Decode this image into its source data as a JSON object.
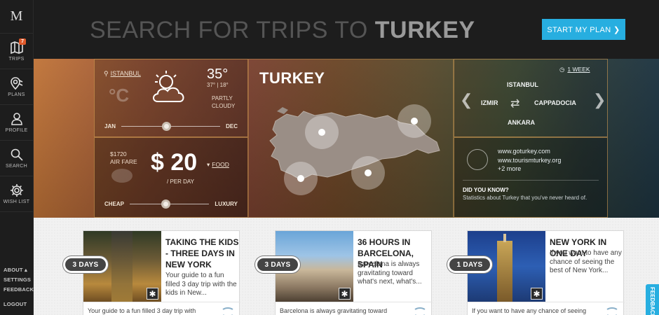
{
  "sidebar": {
    "logo": "M",
    "items": [
      {
        "label": "TRIPS",
        "badge": "7"
      },
      {
        "label": "PLANS"
      },
      {
        "label": "PROFILE"
      },
      {
        "label": "SEARCH"
      },
      {
        "label": "WISH LIST"
      }
    ],
    "bottom": {
      "about": "ABOUT ▴",
      "settings": "SETTINGS",
      "feedback": "FEEDBACK",
      "logout": "LOGOUT"
    }
  },
  "header": {
    "headline_prefix": "SEARCH FOR TRIPS TO",
    "headline_country": "TURKEY",
    "cta_label": "START MY PLAN ❯"
  },
  "weather": {
    "location": "ISTANBUL",
    "unit": "°C",
    "temp": "35°",
    "range": "37° | 18°",
    "condition": "PARTLY CLOUDY",
    "month_start": "JAN",
    "month_end": "DEC"
  },
  "budget": {
    "fare_amount": "$1720",
    "fare_label": "AIR FARE",
    "price": "$ 20",
    "per_day": "/ PER DAY",
    "category": "FOOD",
    "low": "CHEAP",
    "high": "LUXURY",
    "level": 0.45
  },
  "map": {
    "title": "TURKEY"
  },
  "cities": {
    "period": "1 WEEK",
    "north": "ISTANBUL",
    "west": "IZMIR",
    "east": "CAPPADOCIA",
    "south": "ANKARA"
  },
  "info": {
    "sites": [
      "www.goturkey.com",
      "www.tourismturkey.org"
    ],
    "more": "+2 more",
    "dyk_title": "DID YOU KNOW?",
    "dyk_text": "Statistics about Turkey that you've never heard of."
  },
  "trips": [
    {
      "days": "3 DAYS",
      "title": "TAKING THE KIDS - THREE DAYS IN NEW YORK",
      "desc": "Your guide to a fun filled 3 day trip with the kids in New...",
      "foot": "Your guide to a fun filled 3 day trip with"
    },
    {
      "days": "3 DAYS",
      "title": "36 HOURS IN BARCELONA, SPAIN",
      "desc": "Barcelona is always gravitating toward what's next, what's...",
      "foot": "Barcelona is always gravitating toward"
    },
    {
      "days": "1 DAYS",
      "title": "NEW YORK IN ONE DAY",
      "desc": "If you want to have any chance of seeing the best of New York...",
      "foot": "If you want to have any chance of seeing"
    }
  ],
  "feedback_tab": "FEEDBACK",
  "colors": {
    "accent": "#27aee0",
    "badge": "#e05a2b"
  }
}
